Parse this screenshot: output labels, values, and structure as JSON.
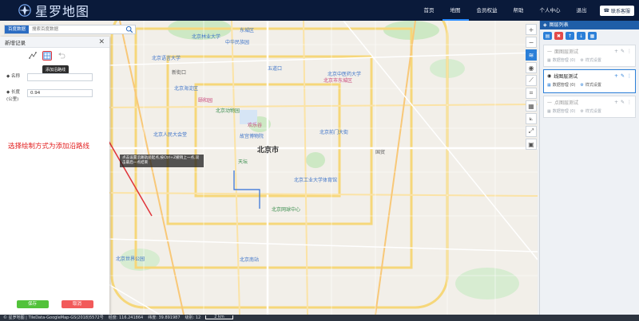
{
  "app": {
    "title": "星罗地图",
    "nav": [
      "首页",
      "地图",
      "会员权益",
      "帮助",
      "个人中心",
      "退出"
    ],
    "active_nav": "地图",
    "contact": "联系客服"
  },
  "search": {
    "type": "百度数据",
    "placeholder": "搜索百度数据"
  },
  "panel": {
    "title": "新增记录",
    "tooltip": "添加沿路线",
    "name_label": "名称",
    "name_value": "",
    "length_label": "长度\n(公里)",
    "length_value": "0.94",
    "annotation": "选择绘制方式为添加沿路线",
    "save": "保存",
    "cancel": "取消"
  },
  "map": {
    "city_label": "北京市",
    "hint": "点击设置沿路轨迹起点,按Ctrl+Z撤销上一点,双击最后一点结束",
    "labels": [
      "东城区",
      "中华民族园",
      "北京林业大学",
      "北京语言大学",
      "北京中医药大学",
      "北京海淀区",
      "颐和园",
      "五道口",
      "北京市东城区",
      "北京动物园",
      "欢乐谷",
      "北京前门大街",
      "北京人民大会堂",
      "故宫博物院",
      "天坛",
      "北京工业大学体育馆",
      "北京网球中心",
      "北京世界公园",
      "新街口",
      "国贸",
      "北京南站"
    ]
  },
  "layers": {
    "title": "图层列表",
    "items": [
      {
        "name": "面图层测试",
        "data": "数据管理 (0)",
        "style": "样式设置",
        "active": false
      },
      {
        "name": "线图层测试",
        "data": "数据管理 (0)",
        "style": "样式设置",
        "active": true
      },
      {
        "name": "点图层测试",
        "data": "数据管理 (0)",
        "style": "样式设置",
        "active": false
      }
    ]
  },
  "status": {
    "source": "© 星罗地图 | TileData-GoogleMap-GS(2018)5572号",
    "lng": "经度: 116.241864",
    "lat": "纬度: 39.891987",
    "zoom": "级别: 12",
    "scale": "2 km"
  },
  "colors": {
    "topbar": "#0a1a3a",
    "accent": "#2b7fd8",
    "annotation": "#e21f1f",
    "save": "#52c23a",
    "cancel": "#f25a5a"
  }
}
